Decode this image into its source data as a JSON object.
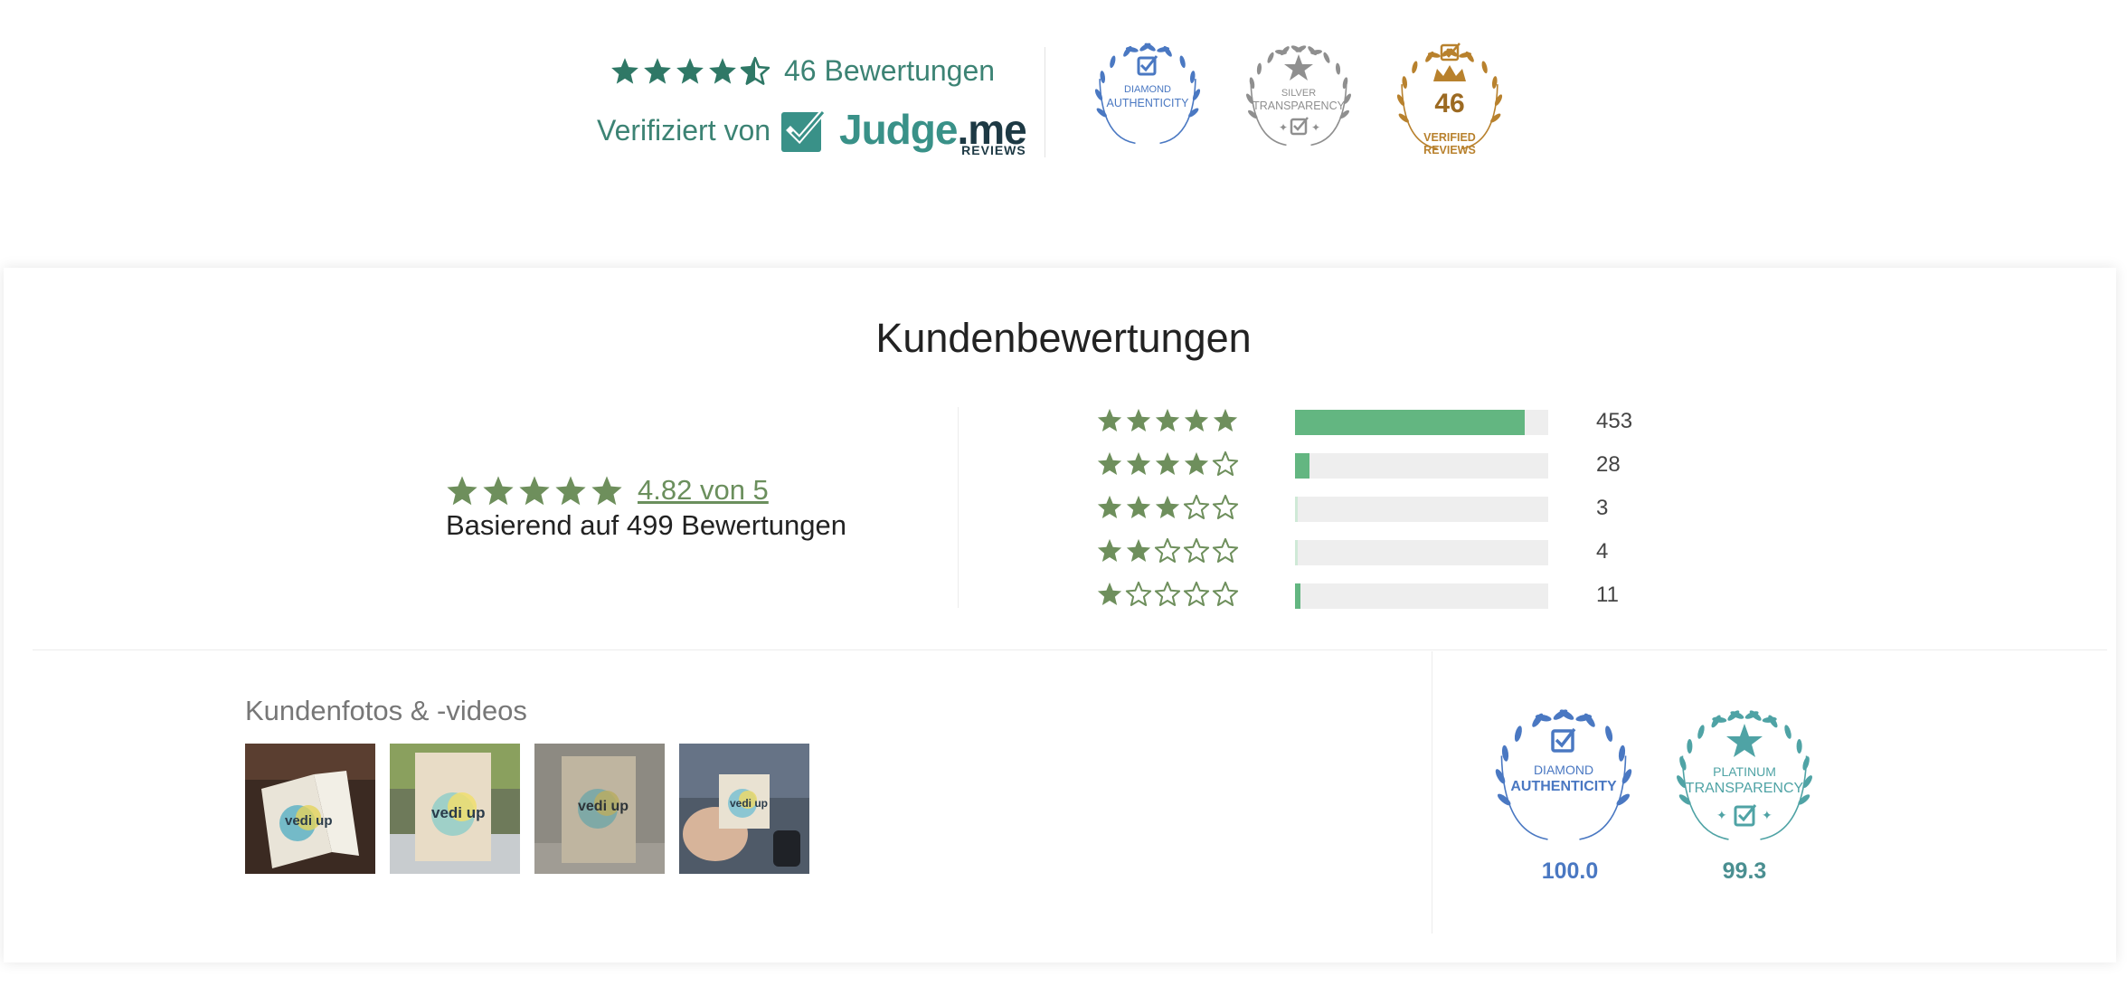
{
  "top_bar": {
    "rating_count_label": "46 Bewertungen",
    "verified_by_label": "Verifiziert von",
    "judgeme_logo": {
      "word_a": "Judge",
      "word_b": ".me",
      "sub": "REVIEWS"
    },
    "badges": [
      {
        "name": "diamond-authenticity-badge",
        "line1": "DIAMOND",
        "line2": "AUTHENTICITY",
        "color": "#4a78c2"
      },
      {
        "name": "silver-transparency-badge",
        "line1": "SILVER",
        "line2": "TRANSPARENCY",
        "color": "#8f8f8f"
      },
      {
        "name": "verified-reviews-badge",
        "number": "46",
        "line1": "VERIFIED",
        "line2": "REVIEWS",
        "color": "#b8812d"
      }
    ],
    "star_color": "#2f7866",
    "average_stars": 4.5
  },
  "reviews": {
    "title": "Kundenbewertungen",
    "average_label": "4.82 von 5",
    "basis_label": "Basierend auf 499 Bewertungen",
    "star_color": "#6e8f5c",
    "histogram": [
      {
        "stars": 5,
        "count": "453",
        "fraction": 0.908
      },
      {
        "stars": 4,
        "count": "28",
        "fraction": 0.056
      },
      {
        "stars": 3,
        "count": "3",
        "fraction": 0.006
      },
      {
        "stars": 2,
        "count": "4",
        "fraction": 0.008
      },
      {
        "stars": 1,
        "count": "11",
        "fraction": 0.022
      }
    ],
    "bar_color": "#63b681"
  },
  "media": {
    "title": "Kundenfotos & -videos",
    "photo_text": "vedi up"
  },
  "transparency": [
    {
      "name": "diamond-authenticity-badge-large",
      "line1": "DIAMOND",
      "line2": "AUTHENTICITY",
      "score": "100.0",
      "color": "#4a78c2"
    },
    {
      "name": "platinum-transparency-badge-large",
      "line1": "PLATINUM",
      "line2": "TRANSPARENCY",
      "score": "99.3",
      "color": "#4fa3a5"
    }
  ]
}
